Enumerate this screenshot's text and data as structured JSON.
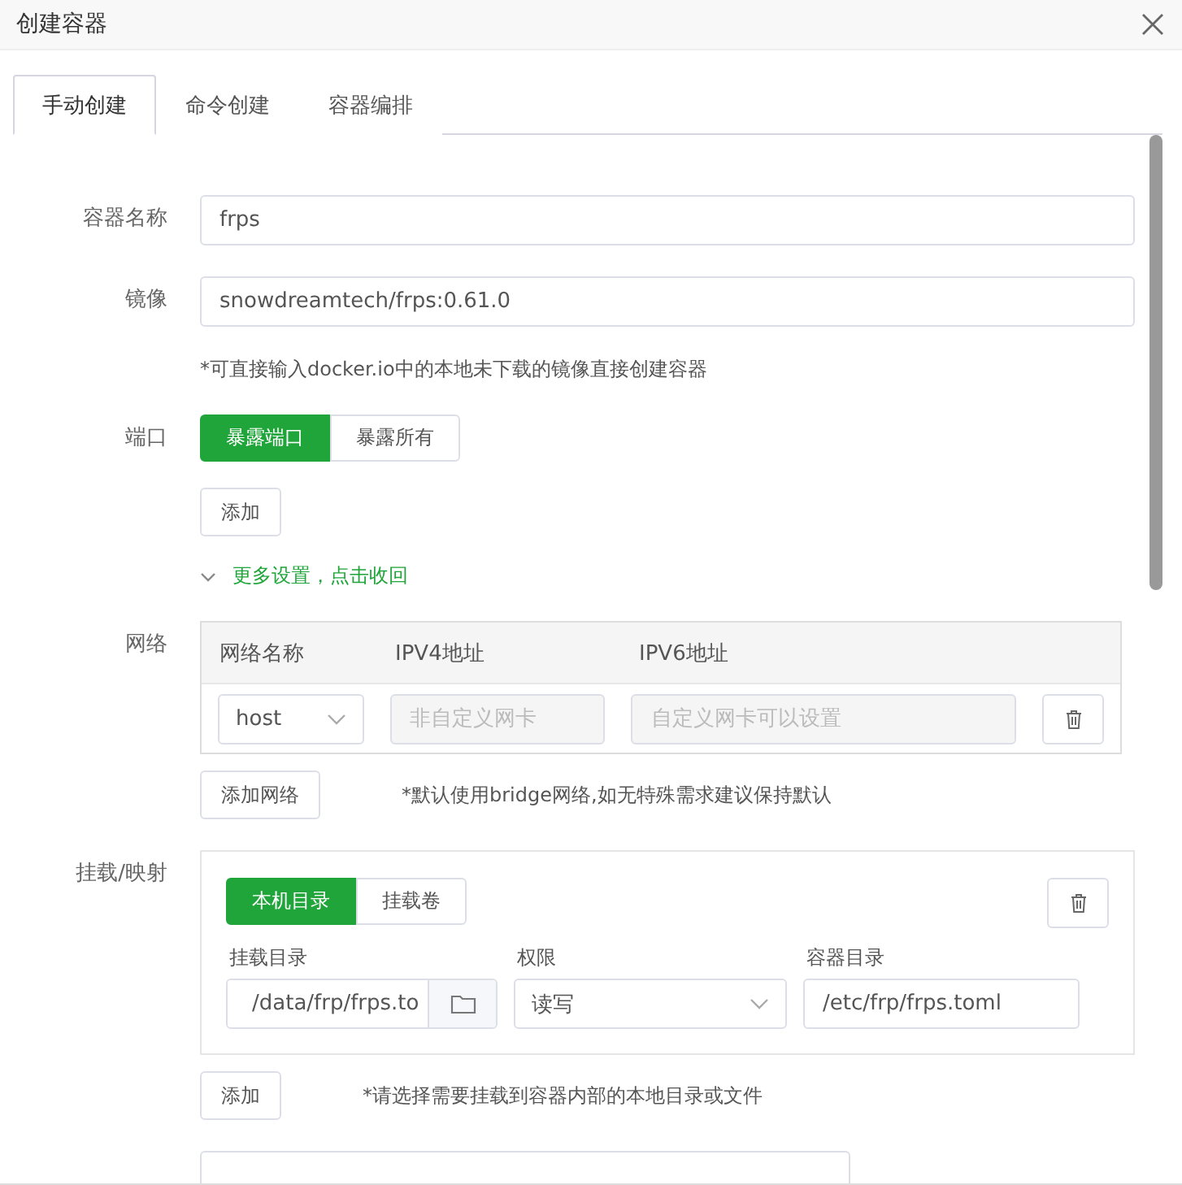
{
  "dialog": {
    "title": "创建容器"
  },
  "tabs": [
    {
      "label": "手动创建",
      "selected": true
    },
    {
      "label": "命令创建",
      "selected": false
    },
    {
      "label": "容器编排",
      "selected": false
    }
  ],
  "form": {
    "name": {
      "label": "容器名称",
      "value": "frps"
    },
    "image": {
      "label": "镜像",
      "value": "snowdreamtech/frps:0.61.0",
      "hint": "*可直接输入docker.io中的本地未下载的镜像直接创建容器"
    },
    "ports": {
      "label": "端口",
      "modes": [
        {
          "label": "暴露端口",
          "selected": true
        },
        {
          "label": "暴露所有",
          "selected": false
        }
      ],
      "add_button": "添加"
    },
    "more_settings": {
      "label": "更多设置，点击收回",
      "expanded": true
    },
    "network": {
      "label": "网络",
      "columns": [
        "网络名称",
        "IPV4地址",
        "IPV6地址"
      ],
      "rows": [
        {
          "name": "host",
          "ipv4_placeholder": "非自定义网卡",
          "ipv6_placeholder": "自定义网卡可以设置",
          "disabled": true
        }
      ],
      "add_button": "添加网络",
      "hint": "*默认使用bridge网络,如无特殊需求建议保持默认"
    },
    "mounts": {
      "label": "挂载/映射",
      "items": [
        {
          "types": [
            {
              "label": "本机目录",
              "selected": true
            },
            {
              "label": "挂载卷",
              "selected": false
            }
          ],
          "host_dir": {
            "label": "挂载目录",
            "value": "/data/frp/frps.to"
          },
          "permission": {
            "label": "权限",
            "value": "读写"
          },
          "container_dir": {
            "label": "容器目录",
            "value": "/etc/frp/frps.toml"
          }
        }
      ],
      "add_button": "添加",
      "hint": "*请选择需要挂载到容器内部的本地目录或文件"
    }
  }
}
